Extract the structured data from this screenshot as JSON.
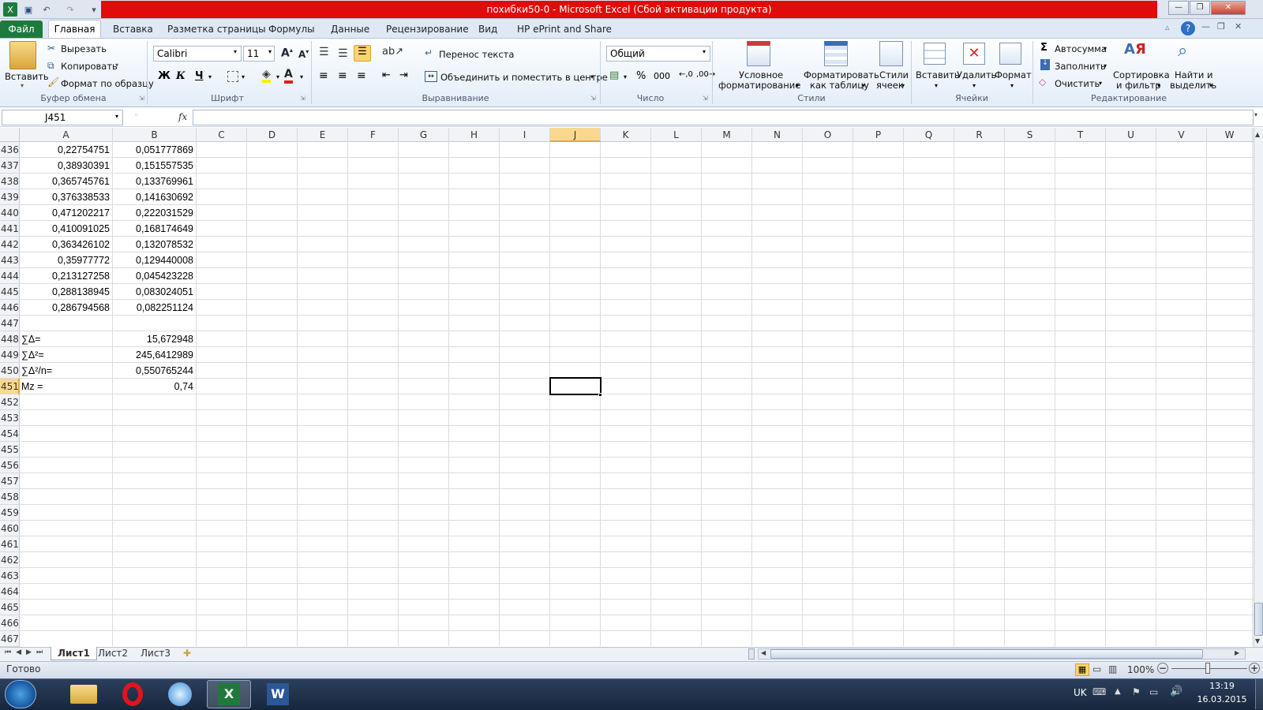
{
  "window": {
    "title": "похибки50-0  -  Microsoft Excel (Сбой активации продукта)"
  },
  "ribbon_tabs": [
    "Файл",
    "Главная",
    "Вставка",
    "Разметка страницы",
    "Формулы",
    "Данные",
    "Рецензирование",
    "Вид",
    "HP ePrint and Share"
  ],
  "ribbon": {
    "clipboard": {
      "paste": "Вставить",
      "cut": "Вырезать",
      "copy": "Копировать",
      "format_painter": "Формат по образцу",
      "label": "Буфер обмена"
    },
    "font": {
      "name": "Calibri",
      "size": "11",
      "bold": "Ж",
      "italic": "К",
      "underline": "Ч",
      "label": "Шрифт"
    },
    "alignment": {
      "wrap": "Перенос текста",
      "merge": "Объединить и поместить в центре",
      "label": "Выравнивание"
    },
    "number": {
      "format": "Общий",
      "label": "Число"
    },
    "styles": {
      "conditional": "Условное",
      "conditional2": "форматирование",
      "as_table": "Форматировать",
      "as_table2": "как таблицу",
      "cell_styles": "Стили",
      "cell_styles2": "ячеек",
      "label": "Стили"
    },
    "cells": {
      "insert": "Вставить",
      "delete": "Удалить",
      "format": "Формат",
      "label": "Ячейки"
    },
    "editing": {
      "autosum": "Автосумма",
      "fill": "Заполнить",
      "clear": "Очистить",
      "sort": "Сортировка",
      "sort2": "и фильтр",
      "find": "Найти и",
      "find2": "выделить",
      "label": "Редактирование"
    }
  },
  "formula_bar": {
    "name_box": "J451",
    "fx": "fx",
    "formula": ""
  },
  "columns": [
    "A",
    "B",
    "C",
    "D",
    "E",
    "F",
    "G",
    "H",
    "I",
    "J",
    "K",
    "L",
    "M",
    "N",
    "O",
    "P",
    "Q",
    "R",
    "S",
    "T",
    "U",
    "V",
    "W"
  ],
  "row_numbers": [
    "436",
    "437",
    "438",
    "439",
    "440",
    "441",
    "442",
    "443",
    "444",
    "445",
    "446",
    "447",
    "448",
    "449",
    "450",
    "451",
    "452",
    "453",
    "454",
    "455",
    "456",
    "457",
    "458",
    "459",
    "460",
    "461",
    "462",
    "463",
    "464",
    "465",
    "466",
    "467"
  ],
  "cells": [
    {
      "a": "0,22754751",
      "b": "0,051777869"
    },
    {
      "a": "0,38930391",
      "b": "0,151557535"
    },
    {
      "a": "0,365745761",
      "b": "0,133769961"
    },
    {
      "a": "0,376338533",
      "b": "0,141630692"
    },
    {
      "a": "0,471202217",
      "b": "0,222031529"
    },
    {
      "a": "0,410091025",
      "b": "0,168174649"
    },
    {
      "a": "0,363426102",
      "b": "0,132078532"
    },
    {
      "a": "0,35977772",
      "b": "0,129440008"
    },
    {
      "a": "0,213127258",
      "b": "0,045423228"
    },
    {
      "a": "0,288138945",
      "b": "0,083024051"
    },
    {
      "a": "0,286794568",
      "b": "0,082251124"
    },
    {
      "a": "",
      "b": ""
    },
    {
      "a": "∑Δ=",
      "b": "15,672948"
    },
    {
      "a": "∑Δ²=",
      "b": "245,6412989"
    },
    {
      "a": "∑Δ²/n=",
      "b": "0,550765244"
    },
    {
      "a": "Mz =",
      "b": "0,74"
    }
  ],
  "sheets": [
    "Лист1",
    "Лист2",
    "Лист3"
  ],
  "status": {
    "ready": "Готово",
    "zoom": "100%"
  },
  "taskbar": {
    "lang": "UK",
    "time": "13:19",
    "date": "16.03.2015"
  }
}
